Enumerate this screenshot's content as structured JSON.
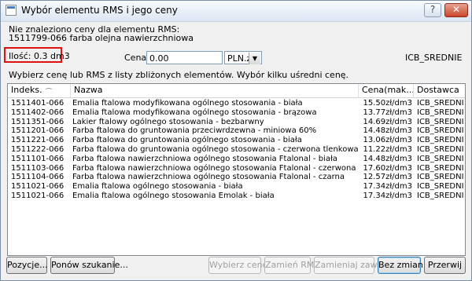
{
  "window": {
    "title": "Wybór elementu RMS i jego ceny"
  },
  "info": {
    "not_found_text": "Nie znaleziono ceny dla elementu RMS:",
    "element_name": "1511799-066 farba olejna nawierzchniowa",
    "quantity_text": "Ilość:  0.3 dm3",
    "price_label": "Cena:",
    "price_value": "0.00",
    "currency": "PLN.zł",
    "supplier": "ICB_SREDNIE"
  },
  "instruction": "Wybierz cenę lub RMS z listy zbliżonych elementów. Wybór kilku uśredni cenę.",
  "table": {
    "columns": [
      "Indeks",
      "Nazwa",
      "Cena(mak...",
      "Dostawca"
    ],
    "rows": [
      {
        "idx": "1511401-066 /2",
        "name": "Emalia ftalowa modyfikowana ogólnego stosowania - biała",
        "price": "15.50zł/dm3",
        "dost": "ICB_SREDNIE"
      },
      {
        "idx": "1511402-066 /2",
        "name": "Emalia ftalowa modyfikowana ogólnego stosowania - brązowa",
        "price": "13.77zł/dm3",
        "dost": "ICB_SREDNIE"
      },
      {
        "idx": "1511351-066 /2",
        "name": "Lakier ftalowy ogólnego stosowania - bezbarwny",
        "price": "14.69zł/dm3",
        "dost": "ICB_SREDNIE"
      },
      {
        "idx": "1511201-066 /2",
        "name": "Farba ftalowa do gruntowania przeciwrdzewna - miniowa 60%",
        "price": "14.48zł/dm3",
        "dost": "ICB_SREDNIE"
      },
      {
        "idx": "1511221-066 /2",
        "name": "Farba ftalowa do gruntowania ogólnego stosowania - biała",
        "price": "13.06zł/dm3",
        "dost": "ICB_SREDNIE"
      },
      {
        "idx": "1511222-066 /2",
        "name": "Farba ftalowa do gruntowania ogólnego stosowania - czerwona tlenkowa",
        "price": "11.22zł/dm3",
        "dost": "ICB_SREDNIE"
      },
      {
        "idx": "1511101-066 /2",
        "name": "Farba ftalowa nawierzchniowa ogólnego stosowania Ftalonal - biała",
        "price": "14.48zł/dm3",
        "dost": "ICB_SREDNIE"
      },
      {
        "idx": "1511103-066 /2",
        "name": "Farba ftalowa nawierzchniowa ogólnego stosowania Ftalonal - czerwona",
        "price": "17.60zł/dm3",
        "dost": "ICB_SREDNIE"
      },
      {
        "idx": "1511104-066 /2",
        "name": "Farba ftalowa nawierzchniowa ogólnego stosowania Ftalonal - czarna",
        "price": "12.57zł/dm3",
        "dost": "ICB_SREDNIE"
      },
      {
        "idx": "1511021-066 /2",
        "name": "Emalia ftalowa ogólnego stosowania - biała",
        "price": "17.34zł/dm3",
        "dost": "ICB_SREDNIE"
      },
      {
        "idx": "1511021-066 /2",
        "name": "Emalia ftalowa ogólnego stosowania Emolak - biała",
        "price": "17.34zł/dm3",
        "dost": "ICB_SREDNIE"
      }
    ]
  },
  "buttons": {
    "positions": "Pozycje...",
    "search_again": "Ponów szukanie...",
    "choose_price": "Wybierz cenę",
    "replace_rms": "Zamień RMS",
    "replace_always": "Zamieniaj zawsze",
    "no_change": "Bez zmian",
    "abort": "Przerwij"
  },
  "icons": {
    "help": "help-icon",
    "close": "close-icon",
    "sort": "sort-icon",
    "dropdown": "chevron-down-icon"
  }
}
